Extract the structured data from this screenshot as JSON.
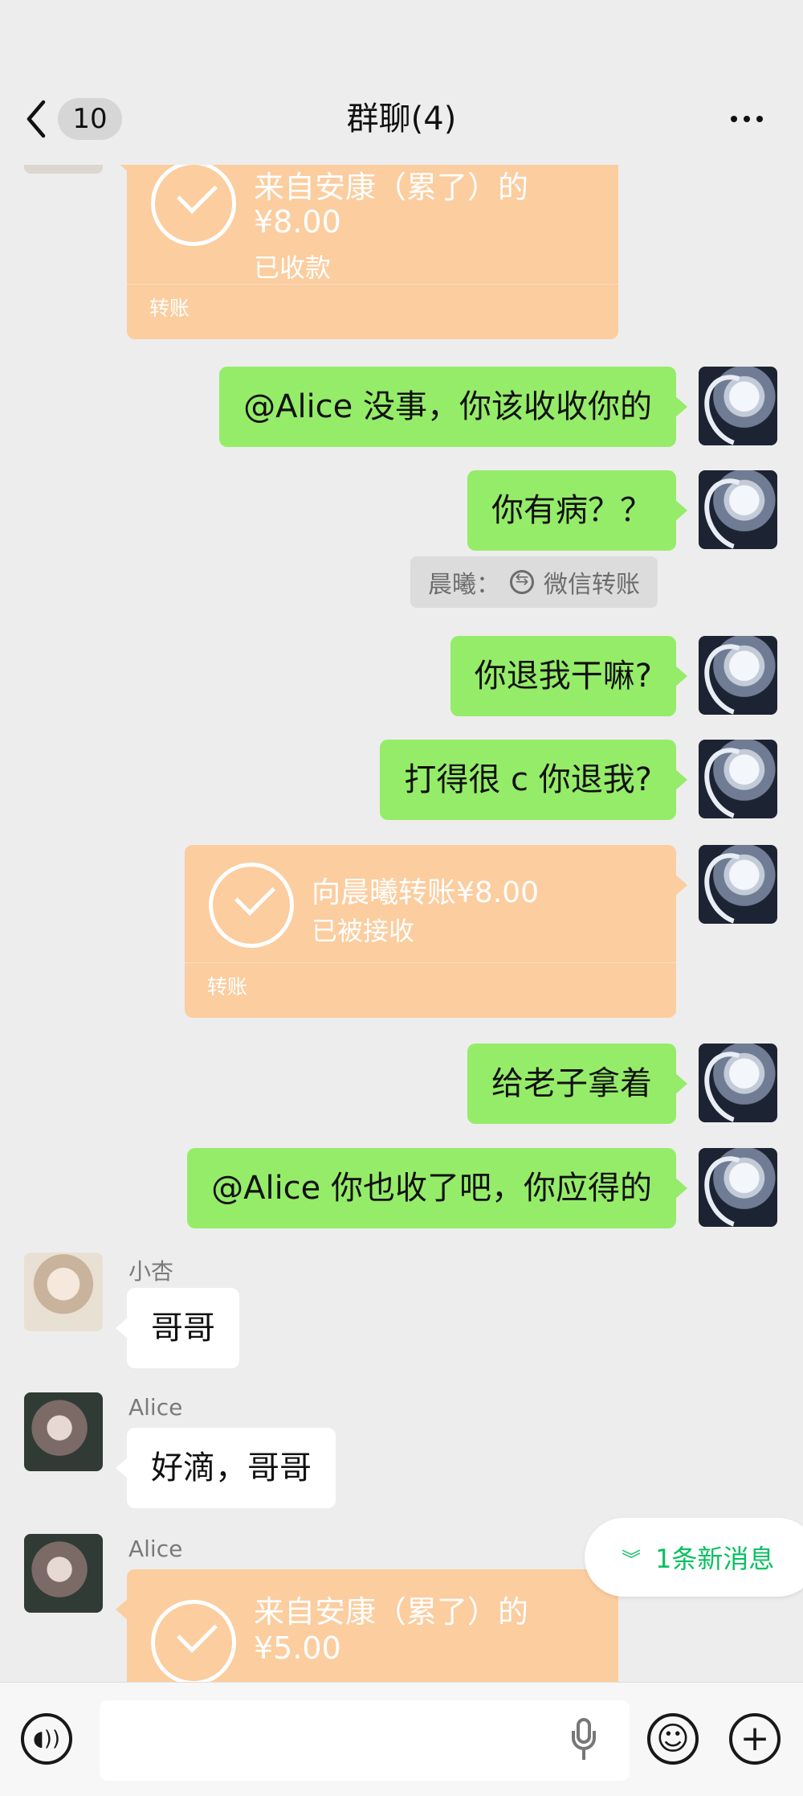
{
  "header": {
    "back_icon": "chevron-left-icon",
    "unread_count": "10",
    "title": "群聊(4)",
    "more_icon": "more-dots-icon"
  },
  "messages": {
    "m0": {
      "type": "transfer",
      "side": "left",
      "amount_line": "来自安康（累了）的",
      "amount": "¥8.00",
      "status": "已收款",
      "footer": "转账"
    },
    "m1": {
      "type": "text",
      "side": "right",
      "text": "@Alice 没事，你该收收你的"
    },
    "m2": {
      "type": "text",
      "side": "right",
      "text": "你有病？？"
    },
    "sys": {
      "prefix": "晨曦：",
      "icon": "transfer-icon",
      "text": "微信转账"
    },
    "m3": {
      "type": "text",
      "side": "right",
      "text": "你退我干嘛?"
    },
    "m4": {
      "type": "text",
      "side": "right",
      "text": "打得很 c 你退我?"
    },
    "m5": {
      "type": "transfer",
      "side": "right",
      "amount_line": "向晨曦转账¥8.00",
      "status": "已被接收",
      "footer": "转账"
    },
    "m6": {
      "type": "text",
      "side": "right",
      "text": "给老子拿着"
    },
    "m7": {
      "type": "text",
      "side": "right",
      "text": "@Alice 你也收了吧，你应得的"
    },
    "m8": {
      "type": "text",
      "side": "left",
      "sender": "小杏",
      "text": "哥哥"
    },
    "m9": {
      "type": "text",
      "side": "left",
      "sender": "Alice",
      "text": "好滴，哥哥"
    },
    "m10": {
      "type": "transfer",
      "side": "left",
      "sender": "Alice",
      "amount_line": "来自安康（累了）的",
      "amount": "¥5.00"
    }
  },
  "new_message_pill": {
    "icon": "double-chevron-down-icon",
    "label": "1条新消息"
  },
  "input_bar": {
    "voice_icon": "voice-icon",
    "mic_icon": "microphone-icon",
    "emoji_icon": "emoji-icon",
    "plus_icon": "plus-icon",
    "placeholder": ""
  },
  "colors": {
    "background": "#ededed",
    "outgoing_bubble": "#95ec69",
    "incoming_bubble": "#ffffff",
    "transfer_card": "#fbcd9f",
    "accent": "#07c160"
  }
}
